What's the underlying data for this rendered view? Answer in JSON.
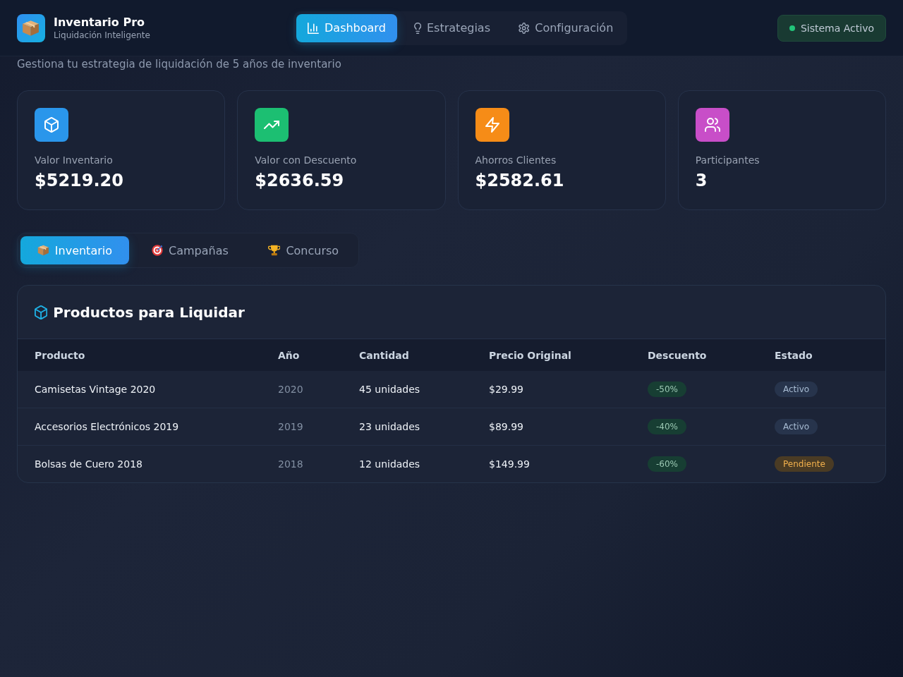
{
  "app": {
    "title": "Inventario Pro",
    "subtitle": "Liquidación Inteligente"
  },
  "nav": [
    {
      "label": "Dashboard",
      "selected": true
    },
    {
      "label": "Estrategias",
      "selected": false
    },
    {
      "label": "Configuración",
      "selected": false
    }
  ],
  "system_status": {
    "label": "Sistema Activo"
  },
  "page": {
    "subtitle": "Gestiona tu estrategia de liquidación de 5 años de inventario"
  },
  "stats": [
    {
      "label": "Valor Inventario",
      "value": "$5219.20",
      "color": "#2a96eb"
    },
    {
      "label": "Valor con Descuento",
      "value": "$2636.59",
      "color": "#1cbf72"
    },
    {
      "label": "Ahorros Clientes",
      "value": "$2582.61",
      "color": "#f68c17"
    },
    {
      "label": "Participantes",
      "value": "3",
      "color": "#c84ec8"
    }
  ],
  "tabs": [
    {
      "label": "Inventario",
      "selected": true
    },
    {
      "label": "Campañas",
      "selected": false
    },
    {
      "label": "Concurso",
      "selected": false
    }
  ],
  "table": {
    "title": "Productos para Liquidar",
    "columns": [
      "Producto",
      "Año",
      "Cantidad",
      "Precio Original",
      "Descuento",
      "Estado"
    ],
    "rows": [
      {
        "product": "Camisetas Vintage 2020",
        "year": "2020",
        "quantity": "45 unidades",
        "price": "$29.99",
        "discount": "-50%",
        "status": {
          "label": "Activo",
          "kind": "active"
        }
      },
      {
        "product": "Accesorios Electrónicos 2019",
        "year": "2019",
        "quantity": "23 unidades",
        "price": "$89.99",
        "discount": "-40%",
        "status": {
          "label": "Activo",
          "kind": "active"
        }
      },
      {
        "product": "Bolsas de Cuero 2018",
        "year": "2018",
        "quantity": "12 unidades",
        "price": "$149.99",
        "discount": "-60%",
        "status": {
          "label": "Pendiente",
          "kind": "pending"
        }
      }
    ]
  }
}
